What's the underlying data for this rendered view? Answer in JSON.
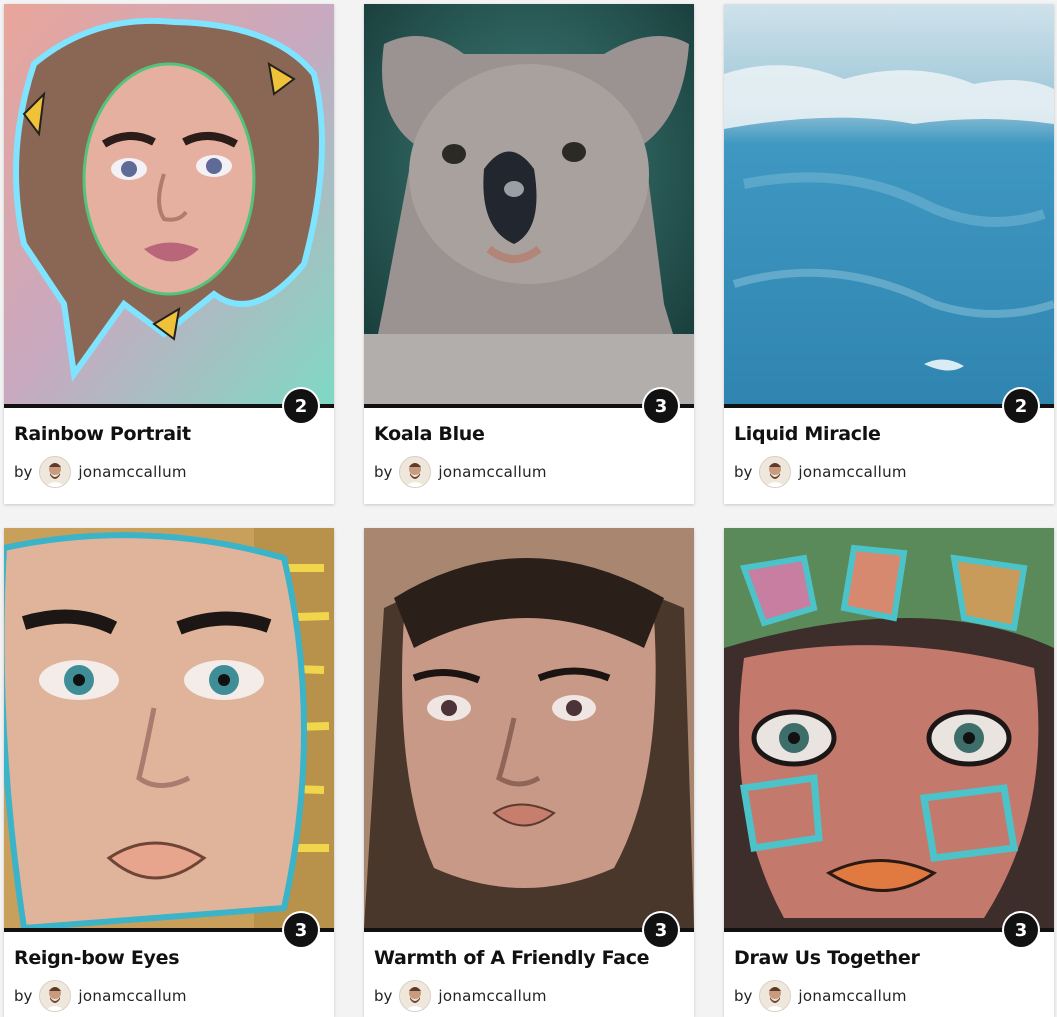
{
  "gallery": {
    "by_label": "by",
    "cards": [
      {
        "title": "Rainbow Portrait",
        "author": "jonamccallum",
        "count": "2",
        "art": "rainbow-portrait"
      },
      {
        "title": "Koala Blue",
        "author": "jonamccallum",
        "count": "3",
        "art": "koala"
      },
      {
        "title": "Liquid Miracle",
        "author": "jonamccallum",
        "count": "2",
        "art": "wave"
      },
      {
        "title": "Reign-bow Eyes",
        "author": "jonamccallum",
        "count": "3",
        "art": "reignbow-eyes"
      },
      {
        "title": "Warmth of A Friendly Face",
        "author": "jonamccallum",
        "count": "3",
        "art": "friendly-face"
      },
      {
        "title": "Draw Us Together",
        "author": "jonamccallum",
        "count": "3",
        "art": "draw-us-together"
      }
    ]
  },
  "colors": {
    "badge_bg": "#111111",
    "card_bg": "#ffffff",
    "page_bg": "#f3f3f3"
  }
}
